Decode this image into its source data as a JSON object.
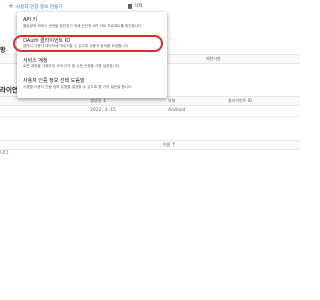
{
  "toolbar": {
    "create_label": "사용자 인증 정보 만들기",
    "delete_label": "삭제"
  },
  "menu": {
    "items": [
      {
        "title": "API 키",
        "desc": "할당량과 액세스 권한을 확인하기 위해 간단한 API 키로 프로젝트를 확인합니다"
      },
      {
        "title": "OAuth 클라이언트 ID",
        "desc": "앱에서 사용자 데이터에 액세스할 수 있도록 사용자 동의를 요청합니다."
      },
      {
        "title": "서비스 계정",
        "desc": "로봇 계정을 사용하여 서버 간의 앱 수준 인증을 사용 설정합니다."
      },
      {
        "title": "사용자 인증 정보 선택 도움말",
        "desc": "사용할 사용자 인증 정보 유형을 결정할 수 있도록 몇 가지 질문을 합니다."
      }
    ]
  },
  "background": {
    "section1_fragment": "항",
    "section2_fragment": "라이언트",
    "api_keys_header_right": "제한사항",
    "oauth_table": {
      "headers": {
        "created": "생성일",
        "sort": "↓",
        "type": "유형",
        "client_id": "클라이언트 ID"
      },
      "row": {
        "created": "2022. 3. 15.",
        "type": "Android"
      }
    },
    "service_table": {
      "headers": {
        "name": "이름",
        "sort": "↑"
      }
    },
    "empty_fragment": "니다."
  }
}
